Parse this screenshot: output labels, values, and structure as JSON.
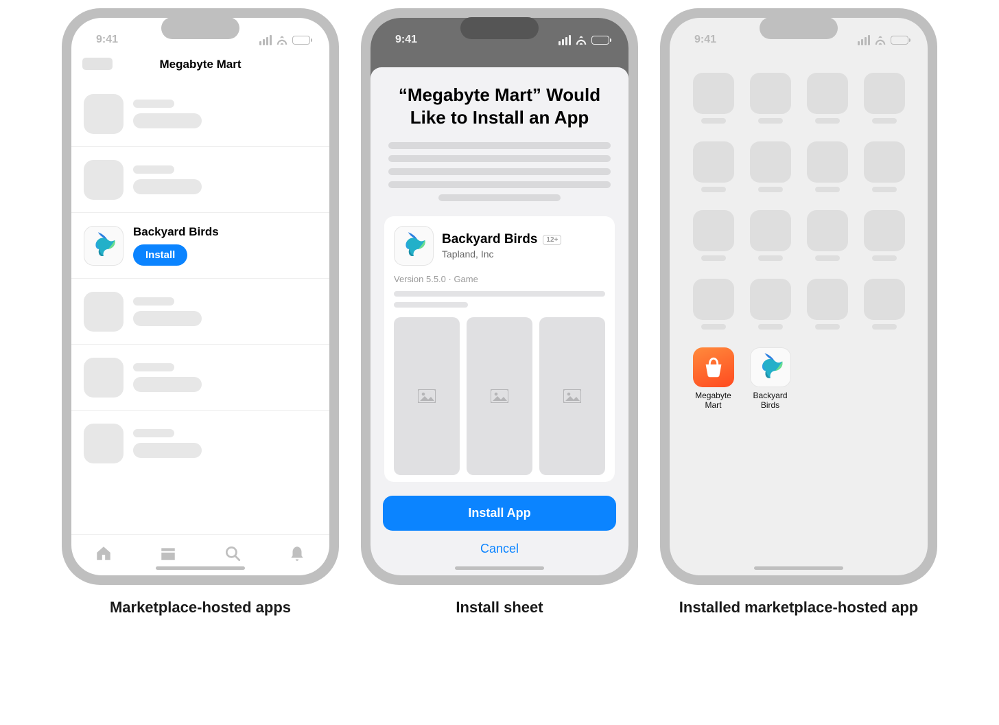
{
  "status": {
    "time": "9:41"
  },
  "screen1": {
    "title": "Megabyte Mart",
    "app_name": "Backyard Birds",
    "install_label": "Install"
  },
  "screen2": {
    "title": "“Megabyte Mart” Would Like to Install an App",
    "app_name": "Backyard Birds",
    "age_rating": "12+",
    "developer": "Tapland, Inc",
    "meta": "Version 5.5.0 · Game",
    "install_label": "Install App",
    "cancel_label": "Cancel"
  },
  "screen3": {
    "app1_label": "Megabyte Mart",
    "app2_label": "Backyard Birds"
  },
  "captions": {
    "c1": "Marketplace-hosted apps",
    "c2": "Install sheet",
    "c3": "Installed marketplace-hosted app"
  }
}
